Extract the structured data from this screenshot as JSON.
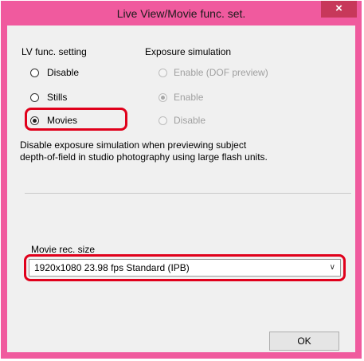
{
  "window": {
    "title": "Live View/Movie func. set.",
    "close_label": "×"
  },
  "lv_func": {
    "heading": "LV func. setting",
    "options": [
      {
        "label": "Disable",
        "checked": false
      },
      {
        "label": "Stills",
        "checked": false
      },
      {
        "label": "Movies",
        "checked": true
      }
    ]
  },
  "exposure": {
    "heading": "Exposure simulation",
    "options": [
      {
        "label": "Enable (DOF preview)",
        "checked": false
      },
      {
        "label": "Enable",
        "checked": true
      },
      {
        "label": "Disable",
        "checked": false
      }
    ],
    "enabled": false
  },
  "description": {
    "line1": "Disable exposure simulation when previewing subject",
    "line2": "depth-of-field in studio photography using large flash units."
  },
  "movie_rec": {
    "label": "Movie rec. size",
    "selected": "1920x1080  23.98 fps Standard (IPB)",
    "chevron": "∨"
  },
  "buttons": {
    "ok": "OK"
  },
  "colors": {
    "titlebar": "#f05a9e",
    "close": "#c7385a",
    "highlight": "#e0001b"
  }
}
